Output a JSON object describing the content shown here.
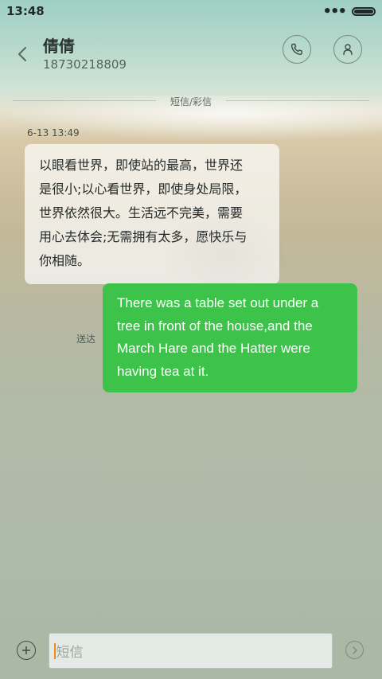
{
  "status_bar": {
    "time": "13:48",
    "more_icon": "more-dots-icon",
    "battery_icon": "battery-icon"
  },
  "header": {
    "contact_name": "倩倩",
    "contact_number": "18730218809",
    "back_icon": "chevron-left-icon",
    "call_icon": "phone-icon",
    "profile_icon": "person-icon"
  },
  "thread": {
    "divider_label": "短信/彩信",
    "incoming": {
      "timestamp": "6-13 13:49",
      "lines": [
        "以眼看世界，即使站的最高，世界还",
        "是很小;以心看世界，即使身处局限，",
        "世界依然很大。生活远不完美，需要",
        "用心去体会;无需拥有太多，愿快乐与",
        "你相随。"
      ]
    },
    "outgoing": {
      "status": "送达",
      "lines": [
        "There was a table set out under a",
        "tree in front of the house,and the",
        "March Hare and the Hatter were",
        "having tea at it."
      ],
      "bubble_color": "#3dc34a"
    }
  },
  "composer": {
    "placeholder": "短信",
    "add_icon": "plus-circle-icon",
    "send_icon": "send-arrow-icon"
  }
}
